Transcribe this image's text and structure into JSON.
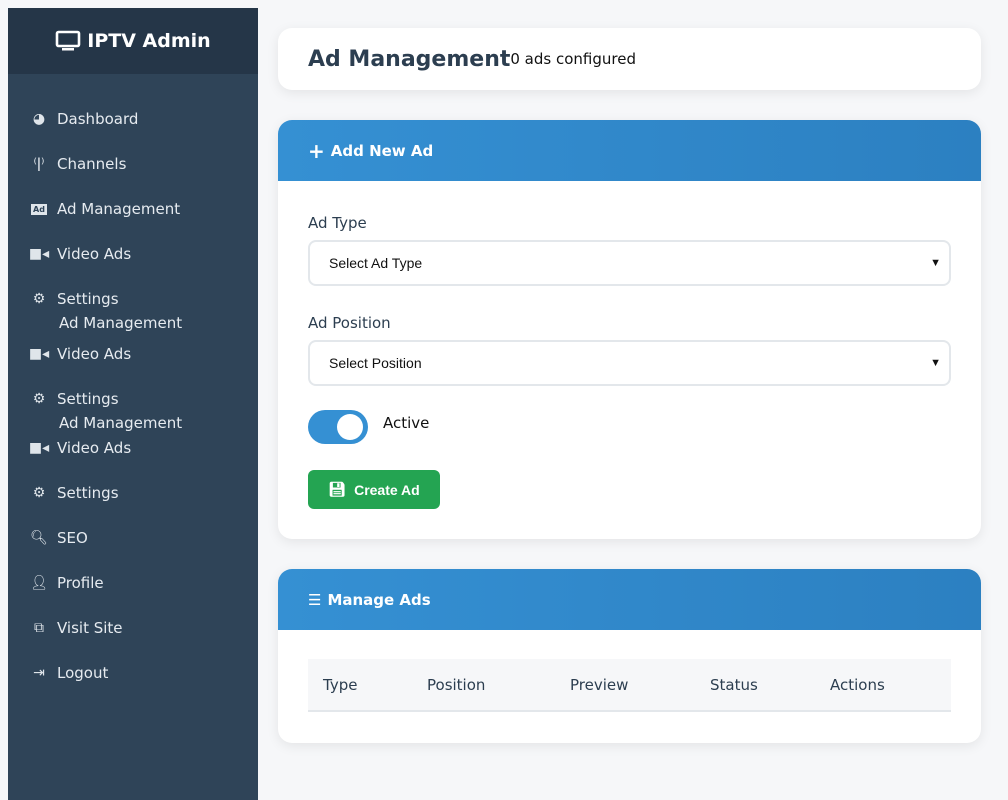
{
  "brand": {
    "title": "IPTV Admin",
    "icon": "tv-icon"
  },
  "sidebar": {
    "items": [
      {
        "label": "Dashboard",
        "icon": "gauge-icon"
      },
      {
        "label": "Channels",
        "icon": "broadcast-icon"
      },
      {
        "label": "Ad Management",
        "icon": "ad-icon"
      },
      {
        "label": "Video Ads",
        "icon": "video-icon"
      },
      {
        "label": "Settings",
        "icon": "gear-icon"
      },
      {
        "label": "Video Ads",
        "icon": "video-icon"
      },
      {
        "label": "Settings",
        "icon": "gear-icon"
      },
      {
        "label": "Video Ads",
        "icon": "video-icon"
      },
      {
        "label": "Settings",
        "icon": "gear-icon"
      },
      {
        "label": "SEO",
        "icon": "search-icon"
      },
      {
        "label": "Profile",
        "icon": "user-icon"
      },
      {
        "label": "Visit Site",
        "icon": "external-link-icon"
      },
      {
        "label": "Logout",
        "icon": "logout-icon"
      }
    ],
    "ghost_label": "Ad Management"
  },
  "header": {
    "title": "Ad Management",
    "subtitle": "0 ads configured"
  },
  "add_form": {
    "title": "Add New Ad",
    "ad_type_label": "Ad Type",
    "ad_type_value": "Select Ad Type",
    "position_label": "Ad Position",
    "position_value": "Select Position",
    "active_label": "Active",
    "active": true,
    "submit": "Create Ad"
  },
  "manage": {
    "title": "Manage Ads",
    "columns": [
      "Type",
      "Position",
      "Preview",
      "Status",
      "Actions"
    ]
  },
  "colors": {
    "sidebar": "#2f4458",
    "accent": "#3590d3",
    "success": "#24a452"
  }
}
